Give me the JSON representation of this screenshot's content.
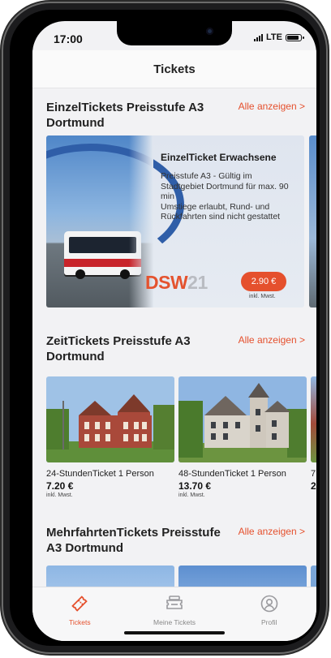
{
  "status_bar": {
    "time": "17:00",
    "network": "LTE"
  },
  "header": {
    "title": "Tickets"
  },
  "sections": [
    {
      "title": "EinzelTickets Preisstufe A3 Dortmund",
      "link": "Alle anzeigen >",
      "card": {
        "title": "EinzelTicket Erwachsene",
        "description": "Preisstufe A3 - Gültig im Stadtgebiet Dortmund für max. 90 min\nUmstiege erlaubt, Rund- und Rückfahrten sind nicht gestattet",
        "logo_main": "DSW",
        "logo_accent": "21",
        "price": "2.90 €",
        "price_note": "inkl. Mwst."
      }
    },
    {
      "title": "ZeitTickets Preisstufe A3 Dortmund",
      "link": "Alle anzeigen >",
      "cards": [
        {
          "name": "24-StundenTicket 1 Person",
          "price": "7.20 €",
          "note": "inkl. Mwst."
        },
        {
          "name": "48-StundenTicket 1 Person",
          "price": "13.70 €",
          "note": "inkl. Mwst."
        }
      ],
      "peek_card": {
        "name": "7",
        "price": "2"
      }
    },
    {
      "title": "MehrfahrtenTickets Preisstufe A3 Dortmund",
      "link": "Alle anzeigen >"
    }
  ],
  "tabbar": {
    "items": [
      {
        "label": "Tickets",
        "icon": "ticket-icon",
        "active": true
      },
      {
        "label": "Meine Tickets",
        "icon": "my-tickets-icon",
        "active": false
      },
      {
        "label": "Profil",
        "icon": "profile-icon",
        "active": false
      }
    ]
  },
  "colors": {
    "accent": "#e5502d",
    "background": "#f2f2f4"
  }
}
